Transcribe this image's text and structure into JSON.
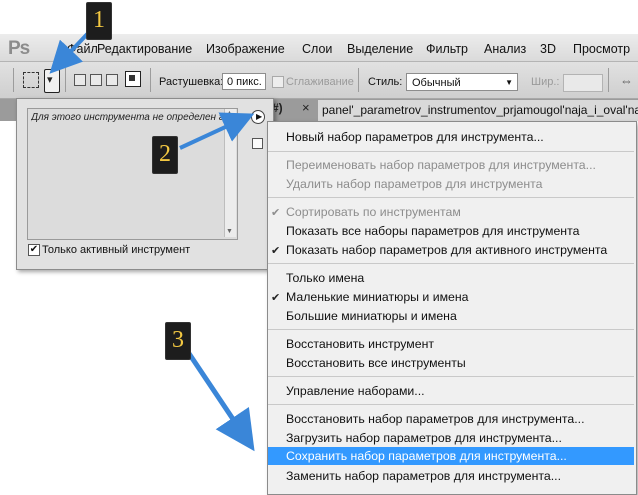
{
  "app": {
    "logo": "Ps"
  },
  "menu_bar": {
    "items": [
      "Файл",
      "Редактирование",
      "Изображение",
      "Слои",
      "Выделение",
      "Фильтр",
      "Анализ",
      "3D",
      "Просмотр"
    ]
  },
  "options_bar": {
    "feather_label": "Растушевка:",
    "feather_value": "0 пикс.",
    "antialias_label": "Сглаживание",
    "style_label": "Стиль:",
    "style_value": "Обычный",
    "width_label": "Шир.:"
  },
  "document_tab": {
    "fragment": "#)",
    "close_glyph": "×",
    "title": "panel'_parametrov_instrumentov_prjamougol'naja_i_oval'naja"
  },
  "preset_panel": {
    "empty_message": "Для этого инструмента не определен го",
    "current_tool_only_label": "Только активный инструмент",
    "current_tool_only_checked": true
  },
  "preset_menu": {
    "groups": [
      [
        {
          "label": "Новый набор параметров для инструмента...",
          "enabled": true,
          "checked": false
        }
      ],
      [
        {
          "label": "Переименовать набор параметров для инструмента...",
          "enabled": false,
          "checked": false
        },
        {
          "label": "Удалить набор параметров для инструмента",
          "enabled": false,
          "checked": false
        }
      ],
      [
        {
          "label": "Сортировать по инструментам",
          "enabled": false,
          "checked": true
        },
        {
          "label": "Показать все наборы параметров для инструмента",
          "enabled": true,
          "checked": false
        },
        {
          "label": "Показать набор параметров для активного инструмента",
          "enabled": true,
          "checked": true
        }
      ],
      [
        {
          "label": "Только имена",
          "enabled": true,
          "checked": false
        },
        {
          "label": "Маленькие миниатюры и имена",
          "enabled": true,
          "checked": true
        },
        {
          "label": "Большие миниатюры и имена",
          "enabled": true,
          "checked": false
        }
      ],
      [
        {
          "label": "Восстановить инструмент",
          "enabled": true,
          "checked": false
        },
        {
          "label": "Восстановить все инструменты",
          "enabled": true,
          "checked": false
        }
      ],
      [
        {
          "label": "Управление наборами...",
          "enabled": true,
          "checked": false
        }
      ],
      [
        {
          "label": "Восстановить набор параметров для инструмента...",
          "enabled": true,
          "checked": false
        },
        {
          "label": "Загрузить набор параметров для инструмента...",
          "enabled": true,
          "checked": false
        },
        {
          "label": "Сохранить набор параметров для инструмента...",
          "enabled": true,
          "checked": false,
          "highlighted": true
        },
        {
          "label": "Заменить набор параметров для инструмента...",
          "enabled": true,
          "checked": false
        }
      ]
    ]
  },
  "callouts": [
    "1",
    "2",
    "3"
  ],
  "colors": {
    "highlight": "#3399ff",
    "callout_text": "#f3c842",
    "arrow": "#3a86d8"
  },
  "icons": {
    "check": "✔",
    "dropdown": "▾",
    "panel_menu": "▶"
  }
}
